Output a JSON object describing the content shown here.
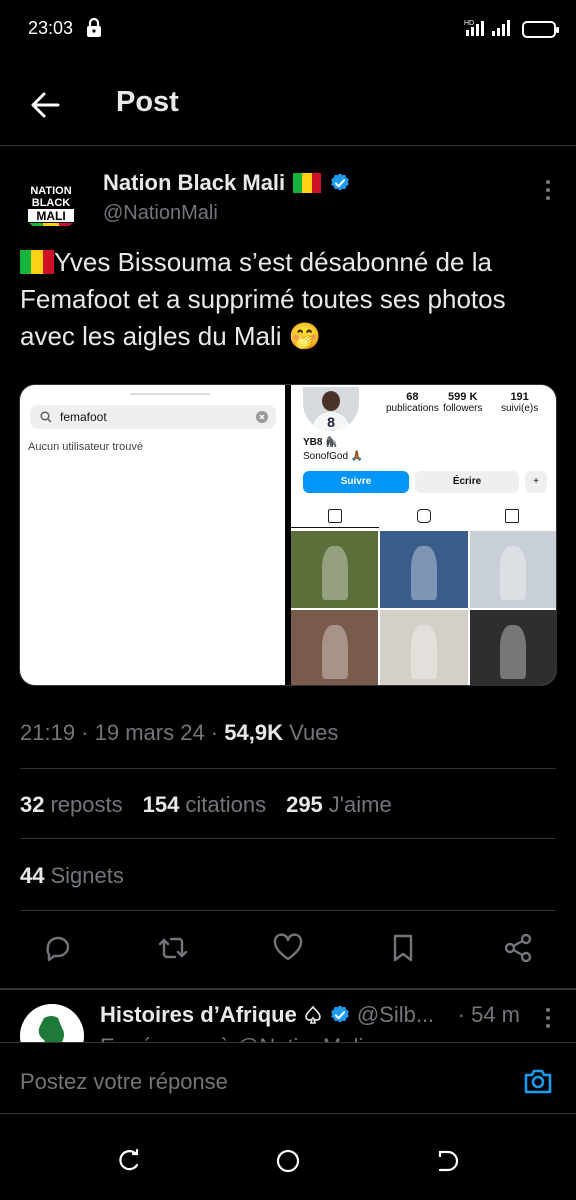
{
  "status_bar": {
    "time": "23:03"
  },
  "header": {
    "title": "Post"
  },
  "tweet": {
    "author_name": "Nation Black Mali",
    "handle": "@NationMali",
    "avatar_text": [
      "NATION",
      "BLACK",
      "MALI"
    ],
    "text_main": "Yves Bissouma s’est désabonné de la Femafoot et a supprimé toutes ses photos avec les aigles du Mali",
    "emoji": "🤭",
    "media_left": {
      "search_text": "femafoot",
      "empty_text": "Aucun utilisateur trouvé"
    },
    "media_right": {
      "stats": [
        {
          "value": "68",
          "label": "publications"
        },
        {
          "value": "599 K",
          "label": "followers"
        },
        {
          "value": "191",
          "label": "suivi(e)s"
        }
      ],
      "name": "YB8 🦍",
      "bio": "SonofGod 🙏🏾",
      "follow_label": "Suivre",
      "message_label": "Écrire",
      "jersey_number": "8",
      "grid_colors": [
        "#5c6e3a",
        "#3a5c8a",
        "#c9cfd6",
        "#7a5a4a",
        "#d4d0c8",
        "#2e2e30"
      ]
    },
    "time": "21:19",
    "date": "19 mars 24",
    "views_count": "54,9K",
    "views_label": "Vues",
    "reposts_count": "32",
    "reposts_label": "reposts",
    "quotes_count": "154",
    "quotes_label": "citations",
    "likes_count": "295",
    "likes_label": "J'aime",
    "bookmarks_count": "44",
    "bookmarks_label": "Signets"
  },
  "reply": {
    "name": "Histoires d’Afrique",
    "handle": "@Silb...",
    "time": "· 54 m",
    "cut_text": "En réponse à @NationMali"
  },
  "compose": {
    "placeholder": "Postez votre réponse"
  },
  "colors": {
    "accent": "#1d9bf0",
    "background": "#000000",
    "text": "#e7e9ea",
    "muted": "#71767b",
    "divider": "#2f3336",
    "mali_green": "#14b53a",
    "mali_yellow": "#fcd116",
    "mali_red": "#ce1126"
  },
  "icons": [
    "back-arrow-icon",
    "lock-icon",
    "signal-icon",
    "battery-icon",
    "verified-icon",
    "more-icon",
    "reply-icon",
    "repost-icon",
    "like-icon",
    "bookmark-icon",
    "share-icon",
    "camera-icon",
    "recents-icon",
    "home-icon",
    "back-icon"
  ]
}
